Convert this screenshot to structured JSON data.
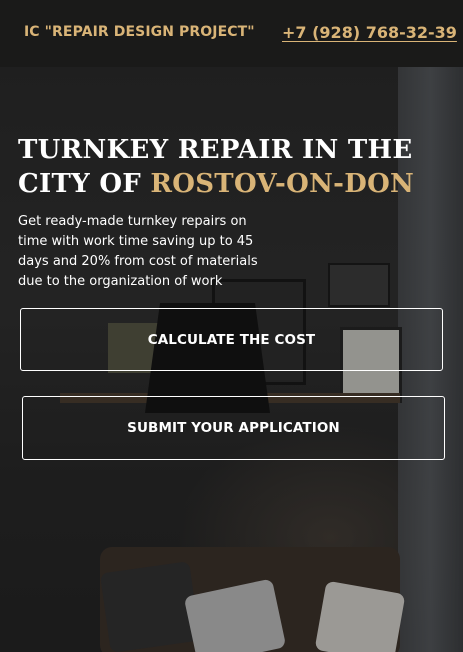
{
  "header": {
    "brand": "IC \"REPAIR DESIGN PROJECT\"",
    "phone": "+7 (928) 768-32-39"
  },
  "hero": {
    "title_prefix": "TURNKEY REPAIR IN THE CITY OF ",
    "title_accent": "ROSTOV-ON-DON",
    "description": "Get ready-made turnkey repairs on time with work time saving up to 45 days and 20% from cost of materials due to the organization of work",
    "calculate_label": "CALCULATE THE COST",
    "submit_label": "SUBMIT YOUR APPLICATION"
  },
  "colors": {
    "accent": "#d9b477",
    "header_bg": "#1a1a19",
    "text": "#ffffff"
  }
}
